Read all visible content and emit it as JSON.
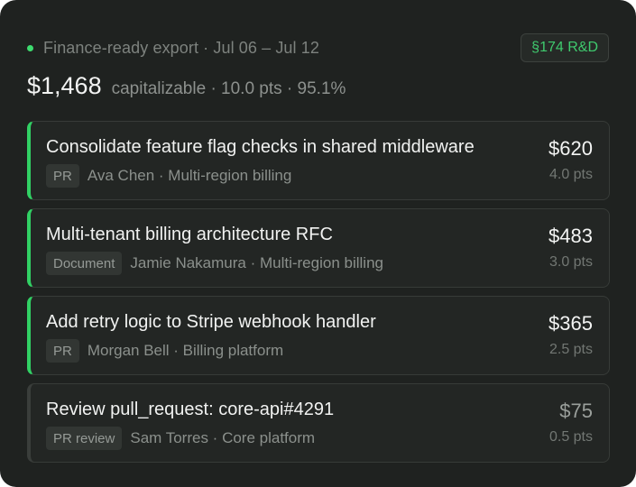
{
  "header": {
    "status_label": "Finance-ready export · Jul 06 – Jul 12",
    "badge": "§174 R&D"
  },
  "summary": {
    "amount": "$1,468",
    "detail": "capitalizable · 10.0 pts · 95.1%"
  },
  "colors": {
    "accent_green": "#31d164",
    "panel_background": "#1f2220"
  },
  "items": [
    {
      "title": "Consolidate feature flag checks in shared middleware",
      "type": "PR",
      "meta": "Ava Chen · Multi-region billing",
      "amount": "$620",
      "points": "4.0 pts",
      "highlighted": true
    },
    {
      "title": "Multi-tenant billing architecture RFC",
      "type": "Document",
      "meta": "Jamie Nakamura · Multi-region billing",
      "amount": "$483",
      "points": "3.0 pts",
      "highlighted": true
    },
    {
      "title": "Add retry logic to Stripe webhook handler",
      "type": "PR",
      "meta": "Morgan Bell · Billing platform",
      "amount": "$365",
      "points": "2.5 pts",
      "highlighted": true
    },
    {
      "title": "Review pull_request: core-api#4291",
      "type": "PR review",
      "meta": "Sam Torres · Core platform",
      "amount": "$75",
      "points": "0.5 pts",
      "highlighted": false
    }
  ]
}
